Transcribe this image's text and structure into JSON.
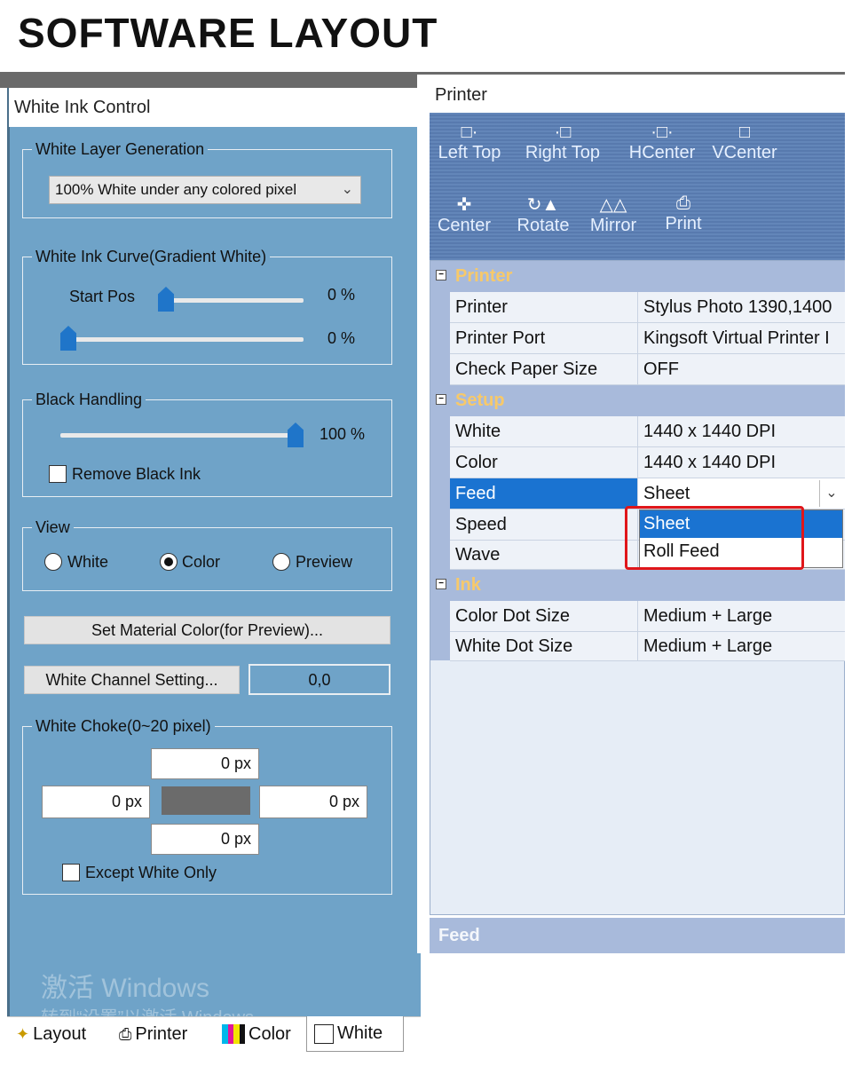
{
  "header": {
    "title": "SOFTWARE LAYOUT"
  },
  "left_panel": {
    "title": "White Ink Control",
    "white_layer": {
      "label": "White Layer Generation",
      "selected": "100% White under any colored pixel"
    },
    "curve": {
      "label": "White Ink Curve(Gradient White)",
      "start_label": "Start Pos",
      "start_value": "0 %",
      "end_value": "0 %",
      "start_level": 0,
      "end_level": 0
    },
    "black": {
      "label": "Black Handling",
      "value": "100 %",
      "level": 100,
      "remove_label": "Remove Black Ink",
      "remove_checked": false
    },
    "view": {
      "label": "View",
      "options": [
        "White",
        "Color",
        "Preview"
      ],
      "selected": "Color"
    },
    "material_button": "Set Material Color(for Preview)...",
    "channel_button": "White Channel Setting...",
    "channel_value": "0,0",
    "choke": {
      "label": "White Choke(0~20 pixel)",
      "top": "0 px",
      "left": "0 px",
      "right": "0 px",
      "bottom": "0 px",
      "except_label": "Except White Only",
      "except_checked": false
    },
    "watermark": {
      "line1": "激活 Windows",
      "line2": "转到“设置”以激活 Windows。"
    },
    "tabs": [
      "Layout",
      "Printer",
      "Color",
      "White"
    ],
    "active_tab": "White"
  },
  "right_panel": {
    "title": "Printer",
    "toolbar": [
      {
        "label": "Left Top",
        "icon": "align-left-top-icon"
      },
      {
        "label": "Right Top",
        "icon": "align-right-top-icon"
      },
      {
        "label": "HCenter",
        "icon": "hcenter-icon"
      },
      {
        "label": "VCenter",
        "icon": "vcenter-icon"
      },
      {
        "label": "Center",
        "icon": "center-icon"
      },
      {
        "label": "Rotate",
        "icon": "rotate-icon"
      },
      {
        "label": "Mirror",
        "icon": "mirror-icon"
      },
      {
        "label": "Print",
        "icon": "printer-icon"
      }
    ],
    "categories": [
      {
        "name": "Printer",
        "rows": [
          {
            "name": "Printer",
            "value": "Stylus Photo 1390,1400"
          },
          {
            "name": "Printer Port",
            "value": "Kingsoft Virtual Printer I"
          },
          {
            "name": "Check Paper Size",
            "value": "OFF"
          }
        ]
      },
      {
        "name": "Setup",
        "rows": [
          {
            "name": "White",
            "value": "1440 x 1440 DPI"
          },
          {
            "name": "Color",
            "value": "1440 x 1440 DPI"
          },
          {
            "name": "Feed",
            "value": "Sheet"
          },
          {
            "name": "Speed",
            "value": ""
          },
          {
            "name": "Wave",
            "value": ""
          }
        ]
      },
      {
        "name": "Ink",
        "rows": [
          {
            "name": "Color Dot Size",
            "value": "Medium + Large"
          },
          {
            "name": "White Dot Size",
            "value": "Medium + Large"
          }
        ]
      }
    ],
    "feed_dropdown": {
      "options": [
        "Sheet",
        "Roll Feed"
      ],
      "highlighted": "Sheet"
    },
    "description_title": "Feed",
    "colors": {
      "accent": "#1a73d1",
      "category_text": "#f7c96a",
      "highlight_box": "#e0161a"
    }
  }
}
